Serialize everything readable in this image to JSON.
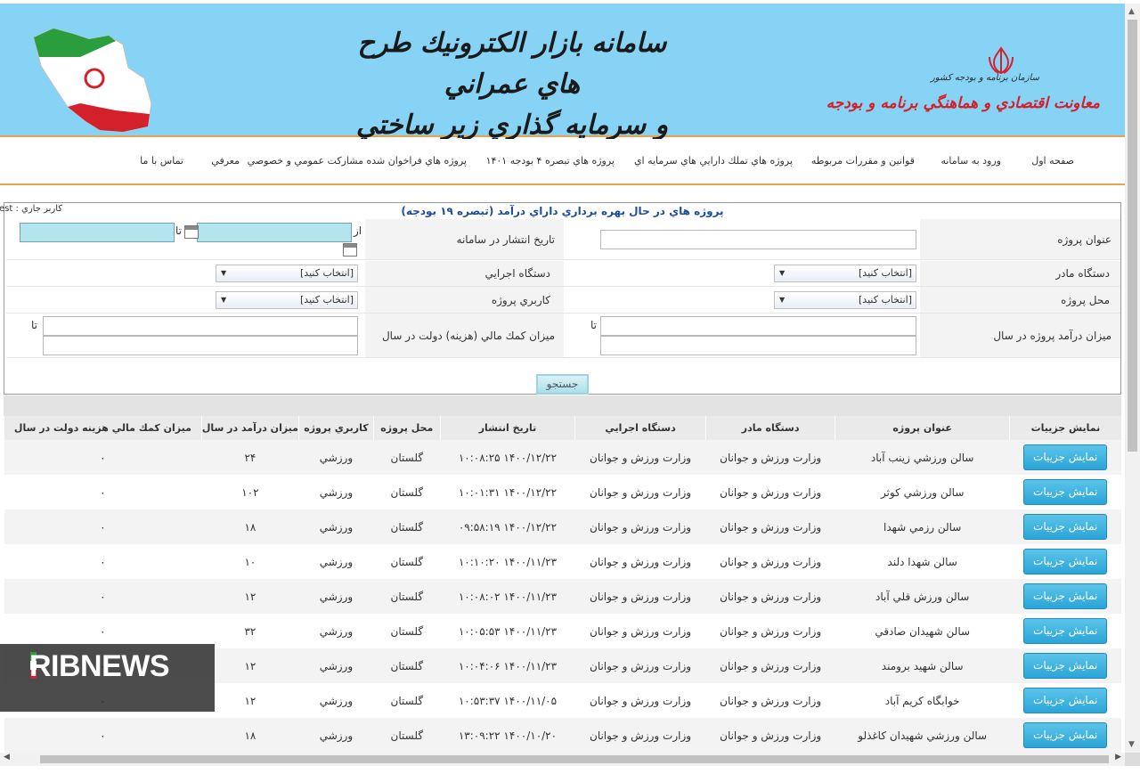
{
  "header": {
    "title_line1": "سامانه بازار الكترونيك طرح هاي عمراني",
    "title_line2": "و سرمايه گذاري زير ساختي",
    "org_small": "سازمان برنامه و بودجه كشور",
    "org_main": "معاونت اقتصادي و هماهنگي برنامه و بودجه"
  },
  "nav": {
    "items": [
      "صفحه اول",
      "ورود به سامانه",
      "قوانين و مقررات مربوطه",
      "پروژه هاي تملك دارايي هاي سرمايه اي",
      "پروژه هاي تبصره ۴ بودجه ۱۴۰۱",
      "پروژه هاي فراخوان شده مشاركت عمومي و خصوصي",
      "معرفي",
      "تماس با ما"
    ]
  },
  "form": {
    "title": "پروژه هاي در حال بهره برداري داراي درآمد (تبصره ۱۹ بودجه)",
    "current_user": "كاربر جاري : est",
    "labels": {
      "project_title": "عنوان پروژه",
      "publish_date": "تاريخ انتشار در سامانه",
      "parent_org": "دستگاه مادر",
      "exec_org": "دستگاه اجرايي",
      "project_location": "محل پروژه",
      "project_usage": "كاربري پروژه",
      "annual_income": "ميزان درآمد پروژه در سال",
      "gov_support": "ميزان كمك مالي (هزينه) دولت در سال"
    },
    "from": "از",
    "to": "تا",
    "select_placeholder": "[انتخاب كنيد]",
    "search_label": "جستجو"
  },
  "table": {
    "headers": [
      "نمايش جزييات",
      "عنوان پروژه",
      "دستگاه مادر",
      "دستگاه اجرايي",
      "تاريخ انتشار",
      "محل پروژه",
      "كاربري پروژه",
      "ميزان درآمد در سال",
      "ميزان كمك مالي هزينه دولت در سال"
    ],
    "detail_button": "نمايش جزييات",
    "rows": [
      [
        "سالن ورزشي زينب آباد",
        "وزارت ورزش و جوانان",
        "وزارت ورزش و جوانان",
        "۱۴۰۰/۱۲/۲۲ ۱۰:۰۸:۲۵",
        "گلستان",
        "ورزشي",
        "۲۴",
        "۰"
      ],
      [
        "سالن ورزشي كوثر",
        "وزارت ورزش و جوانان",
        "وزارت ورزش و جوانان",
        "۱۴۰۰/۱۲/۲۲ ۱۰:۰۱:۳۱",
        "گلستان",
        "ورزشي",
        "۱۰۲",
        "۰"
      ],
      [
        "سالن رزمي شهدا",
        "وزارت ورزش و جوانان",
        "وزارت ورزش و جوانان",
        "۱۴۰۰/۱۲/۲۲ ۰۹:۵۸:۱۹",
        "گلستان",
        "ورزشي",
        "۱۸",
        "۰"
      ],
      [
        "سالن شهدا دلند",
        "وزارت ورزش و جوانان",
        "وزارت ورزش و جوانان",
        "۱۴۰۰/۱۱/۲۳ ۱۰:۱۰:۲۰",
        "گلستان",
        "ورزشي",
        "۱۰",
        "۰"
      ],
      [
        "سالن ورزش قلي آباد",
        "وزارت ورزش و جوانان",
        "وزارت ورزش و جوانان",
        "۱۴۰۰/۱۱/۲۳ ۱۰:۰۸:۰۲",
        "گلستان",
        "ورزشي",
        "۱۲",
        "۰"
      ],
      [
        "سالن شهيدان صادقي",
        "وزارت ورزش و جوانان",
        "وزارت ورزش و جوانان",
        "۱۴۰۰/۱۱/۲۳ ۱۰:۰۵:۵۳",
        "گلستان",
        "ورزشي",
        "۳۲",
        "۰"
      ],
      [
        "سالن شهيد برومند",
        "وزارت ورزش و جوانان",
        "وزارت ورزش و جوانان",
        "۱۴۰۰/۱۱/۲۳ ۱۰:۰۴:۰۶",
        "گلستان",
        "ورزشي",
        "۱۲",
        "۰"
      ],
      [
        "خوابگاه كريم آباد",
        "وزارت ورزش و جوانان",
        "وزارت ورزش و جوانان",
        "۱۴۰۰/۱۱/۰۵ ۱۰:۵۳:۳۷",
        "گلستان",
        "ورزشي",
        "۱۲",
        "۰"
      ],
      [
        "سالن ورزشي شهيدان كاغذلو",
        "وزارت ورزش و جوانان",
        "وزارت ورزش و جوانان",
        "۱۴۰۰/۱۰/۲۰ ۱۳:۰۹:۲۲",
        "گلستان",
        "ورزشي",
        "۱۸",
        "۰"
      ]
    ]
  },
  "watermark": {
    "text": "RIBNEWS"
  },
  "colors": {
    "banner": "#87d3f5",
    "accent": "#e8a24d",
    "title_blue": "#1d4e9e",
    "button": "#2aa5d8"
  }
}
